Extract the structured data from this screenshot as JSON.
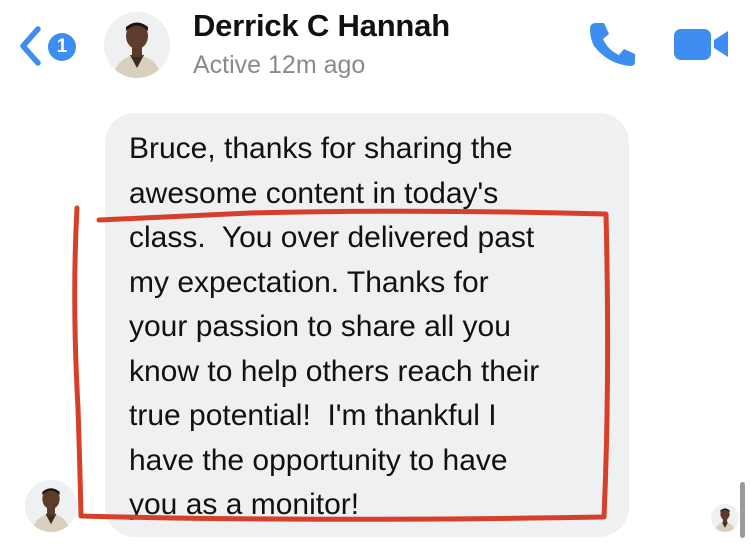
{
  "header": {
    "unread_count": "1",
    "contact_name": "Derrick C Hannah",
    "status": "Active 12m ago",
    "icons": {
      "back": "chevron-left-icon",
      "call": "phone-icon",
      "video": "video-camera-icon"
    }
  },
  "message": {
    "text": "Bruce, thanks for sharing the\nawesome content in today's\nclass.  You over delivered past\nmy expectation. Thanks for\nyour passion to share all you\nknow to help others reach their\ntrue potential!  I'm thankful I\nhave the opportunity to have\nyou as a monitor!"
  },
  "colors": {
    "accent": "#3d8ef0",
    "bubble": "#eff0f2",
    "annotation": "#d6402b",
    "secondary_text": "#8a8a8e"
  }
}
